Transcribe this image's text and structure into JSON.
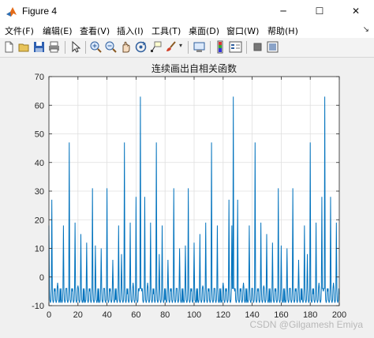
{
  "window": {
    "title": "Figure 4",
    "minimize_glyph": "─",
    "maximize_glyph": "☐",
    "close_glyph": "✕"
  },
  "menu": {
    "items": [
      "文件(F)",
      "编辑(E)",
      "查看(V)",
      "插入(I)",
      "工具(T)",
      "桌面(D)",
      "窗口(W)",
      "帮助(H)"
    ],
    "overflow_glyph": "↘"
  },
  "toolbar": {
    "icons": [
      "new-icon",
      "open-icon",
      "save-icon",
      "print-icon",
      "pointer-icon",
      "zoom-in-icon",
      "zoom-out-icon",
      "pan-icon",
      "rotate-icon",
      "data-cursor-icon",
      "brush-icon",
      "link-icon",
      "colorbar-icon",
      "legend-icon",
      "hide-plot-tools-icon",
      "show-plot-tools-icon"
    ]
  },
  "watermark": "CSDN @Gilgamesh Emiya",
  "colors": {
    "line": "#0072bd",
    "axes": "#262626",
    "grid": "#dfdfdf"
  },
  "chart_data": {
    "type": "line",
    "title": "连续画出自相关函数",
    "xlabel": "",
    "ylabel": "",
    "xlim": [
      0,
      200
    ],
    "ylim": [
      -10,
      70
    ],
    "xticks": [
      0,
      20,
      40,
      60,
      80,
      100,
      120,
      140,
      160,
      180,
      200
    ],
    "yticks": [
      -10,
      0,
      10,
      20,
      30,
      40,
      50,
      60,
      70
    ],
    "grid": true,
    "period": 63,
    "series": [
      {
        "x": [
          0,
          2,
          4,
          6,
          8,
          10,
          12,
          14,
          16,
          18,
          20,
          22,
          24,
          26,
          28,
          30,
          32,
          34,
          36,
          38,
          40,
          42,
          44,
          46,
          48,
          50,
          52,
          54,
          56,
          58,
          60,
          62,
          63,
          64,
          66,
          68,
          70,
          72,
          74,
          76,
          78,
          80,
          82,
          84,
          86,
          88,
          90,
          92,
          94,
          96,
          98,
          100,
          102,
          104,
          106,
          108,
          110,
          112,
          114,
          116,
          118,
          120,
          122,
          124,
          126,
          127,
          128,
          130,
          132,
          134,
          136,
          138,
          140,
          142,
          144,
          146,
          148,
          150,
          152,
          154,
          156,
          158,
          160,
          162,
          164,
          166,
          168,
          170,
          172,
          174,
          176,
          178,
          180,
          182,
          184,
          186,
          188,
          189,
          190,
          192,
          194,
          196,
          198,
          200
        ],
        "values": [
          18,
          27,
          -5,
          -2,
          -9,
          18,
          -4,
          47,
          -5,
          19,
          -3,
          15,
          -9,
          12,
          -5,
          31,
          11,
          -9,
          10,
          -4,
          31,
          -5,
          6,
          -8,
          18,
          8,
          47,
          -6,
          19,
          -2,
          28,
          -5,
          63,
          -5,
          28,
          -2,
          19,
          -6,
          47,
          8,
          18,
          -8,
          6,
          -5,
          31,
          -4,
          10,
          -9,
          11,
          31,
          -5,
          12,
          -9,
          15,
          -3,
          19,
          -5,
          47,
          -4,
          18,
          -9,
          -2,
          -5,
          27,
          18,
          63,
          -5,
          27,
          -5,
          -2,
          -9,
          18,
          -4,
          47,
          -5,
          19,
          -3,
          15,
          -9,
          12,
          -5,
          31,
          11,
          -9,
          10,
          -4,
          31,
          -5,
          6,
          -8,
          18,
          8,
          47,
          -6,
          19,
          -2,
          28,
          -5,
          63,
          -5,
          28,
          -2,
          19,
          -6
        ]
      }
    ]
  }
}
